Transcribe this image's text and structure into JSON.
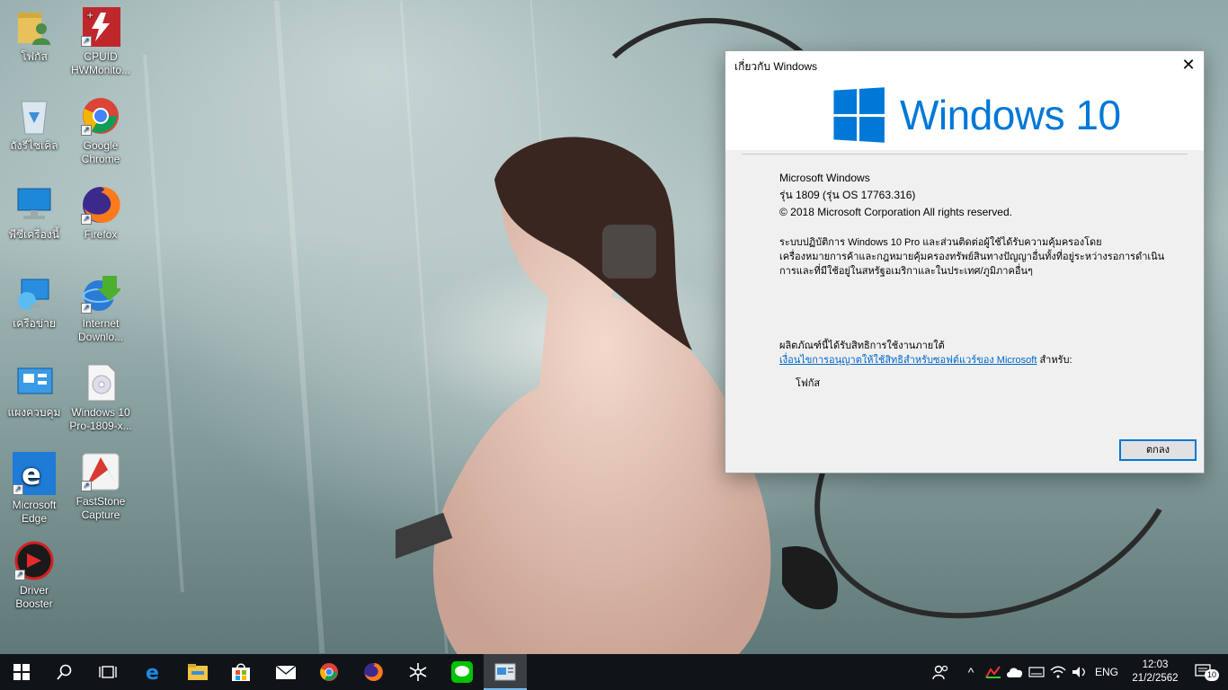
{
  "desktop": {
    "icons": [
      {
        "label": "โฟกัส",
        "icon": "user-folder-icon"
      },
      {
        "label": "CPUID HWMonito...",
        "icon": "cpuid-hwmonitor-icon"
      },
      {
        "label": "ถังรีไซเคิล",
        "icon": "recycle-bin-icon"
      },
      {
        "label": "Google Chrome",
        "icon": "chrome-icon"
      },
      {
        "label": "พีซีเครื่องนี้",
        "icon": "this-pc-icon"
      },
      {
        "label": "Firefox",
        "icon": "firefox-icon"
      },
      {
        "label": "เครือข่าย",
        "icon": "network-icon"
      },
      {
        "label": "Internet Downlo...",
        "icon": "internet-download-manager-icon"
      },
      {
        "label": "แผงควบคุม",
        "icon": "control-panel-icon"
      },
      {
        "label": "Windows 10 Pro-1809-x...",
        "icon": "disc-image-file-icon"
      },
      {
        "label": "Microsoft Edge",
        "icon": "edge-icon"
      },
      {
        "label": "FastStone Capture",
        "icon": "faststone-capture-icon"
      },
      {
        "label": "Driver Booster",
        "icon": "driver-booster-icon"
      }
    ]
  },
  "about_dialog": {
    "title": "เกี่ยวกับ Windows",
    "close_glyph": "✕",
    "wordmark": "Windows 10",
    "product_name": "Microsoft Windows",
    "version": "รุ่น 1809 (รุ่น OS 17763.316)",
    "copyright": "© 2018 Microsoft Corporation All rights reserved.",
    "license_text": "ระบบปฏิบัติการ Windows 10 Pro และส่วนติดต่อผู้ใช้ได้รับความคุ้มครองโดยเครื่องหมายการค้าและกฎหมายคุ้มครองทรัพย์สินทางปัญญาอื่นทั้งที่อยู่ระหว่างรอการดำเนินการและที่มีใช้อยู่ในสหรัฐอเมริกาและในประเทศ/ภูมิภาคอื่นๆ",
    "licensed_under": "ผลิตภัณฑ์นี้ได้รับสิทธิการใช้งานภายใต้",
    "license_link": "เงื่อนไขการอนุญาตให้ใช้สิทธิสำหรับซอฟต์แวร์ของ Microsoft",
    "licensed_for": "สำหรับ:",
    "licensed_user": "โฟกัส",
    "ok_button": "ตกลง",
    "brand_color": "#0078d7"
  },
  "taskbar": {
    "pinned": [
      {
        "icon": "start-windows-icon"
      },
      {
        "icon": "search-icon"
      },
      {
        "icon": "task-view-icon"
      },
      {
        "icon": "edge-icon"
      },
      {
        "icon": "file-explorer-icon"
      },
      {
        "icon": "microsoft-store-icon"
      },
      {
        "icon": "mail-icon"
      },
      {
        "icon": "chrome-icon"
      },
      {
        "icon": "firefox-icon"
      },
      {
        "icon": "snowflake-app-icon"
      },
      {
        "icon": "line-app-icon"
      },
      {
        "icon": "about-windows-icon"
      }
    ],
    "tray": {
      "people_icon": "people-icon",
      "show_hidden_glyph": "^",
      "language": "ENG",
      "time": "12:03",
      "date": "21/2/2562",
      "notification_count": "10"
    }
  }
}
